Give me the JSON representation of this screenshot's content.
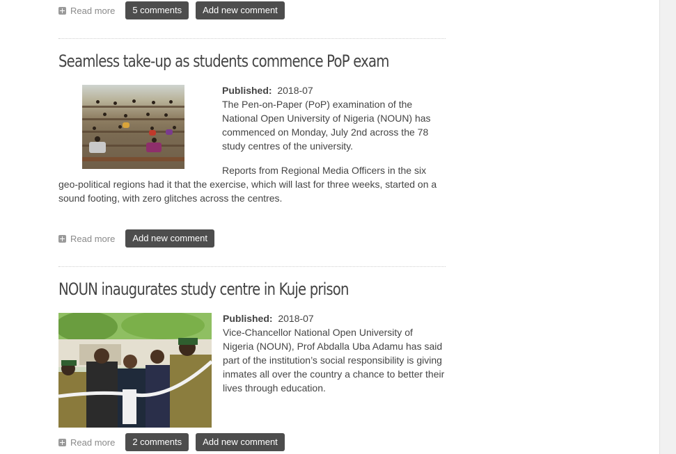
{
  "top_links": {
    "read_more": "Read more",
    "comments": "5 comments",
    "add_comment": "Add new comment"
  },
  "articles": [
    {
      "title": "Seamless take-up as students commence PoP exam",
      "published_label": "Published:",
      "published_value": "2018-07",
      "paragraphs": [
        "The Pen-on-Paper (PoP) examination of the National Open University of Nigeria (NOUN) has commenced on Monday, July 2nd across the 78 study centres of the university.",
        "Reports from Regional Media Officers in the six geo-political regions had it that the exercise, which will last for three weeks, started on a sound footing, with zero glitches across the centres."
      ],
      "read_more": "Read more",
      "add_comment": "Add new comment"
    },
    {
      "title": "NOUN inaugurates study centre in Kuje prison",
      "published_label": "Published:",
      "published_value": "2018-07",
      "paragraphs": [
        "Vice-Chancellor National Open University of Nigeria (NOUN), Prof Abdalla Uba Adamu has said part of the institution’s social responsibility is giving inmates all over the country a chance to better their lives through education."
      ],
      "read_more": "Read more",
      "comments": "2 comments",
      "add_comment": "Add new comment"
    }
  ],
  "colors": {
    "button_bg": "#4d4d4d",
    "button_text": "#ffffff",
    "text": "#444444",
    "muted": "#8a8a8a"
  }
}
